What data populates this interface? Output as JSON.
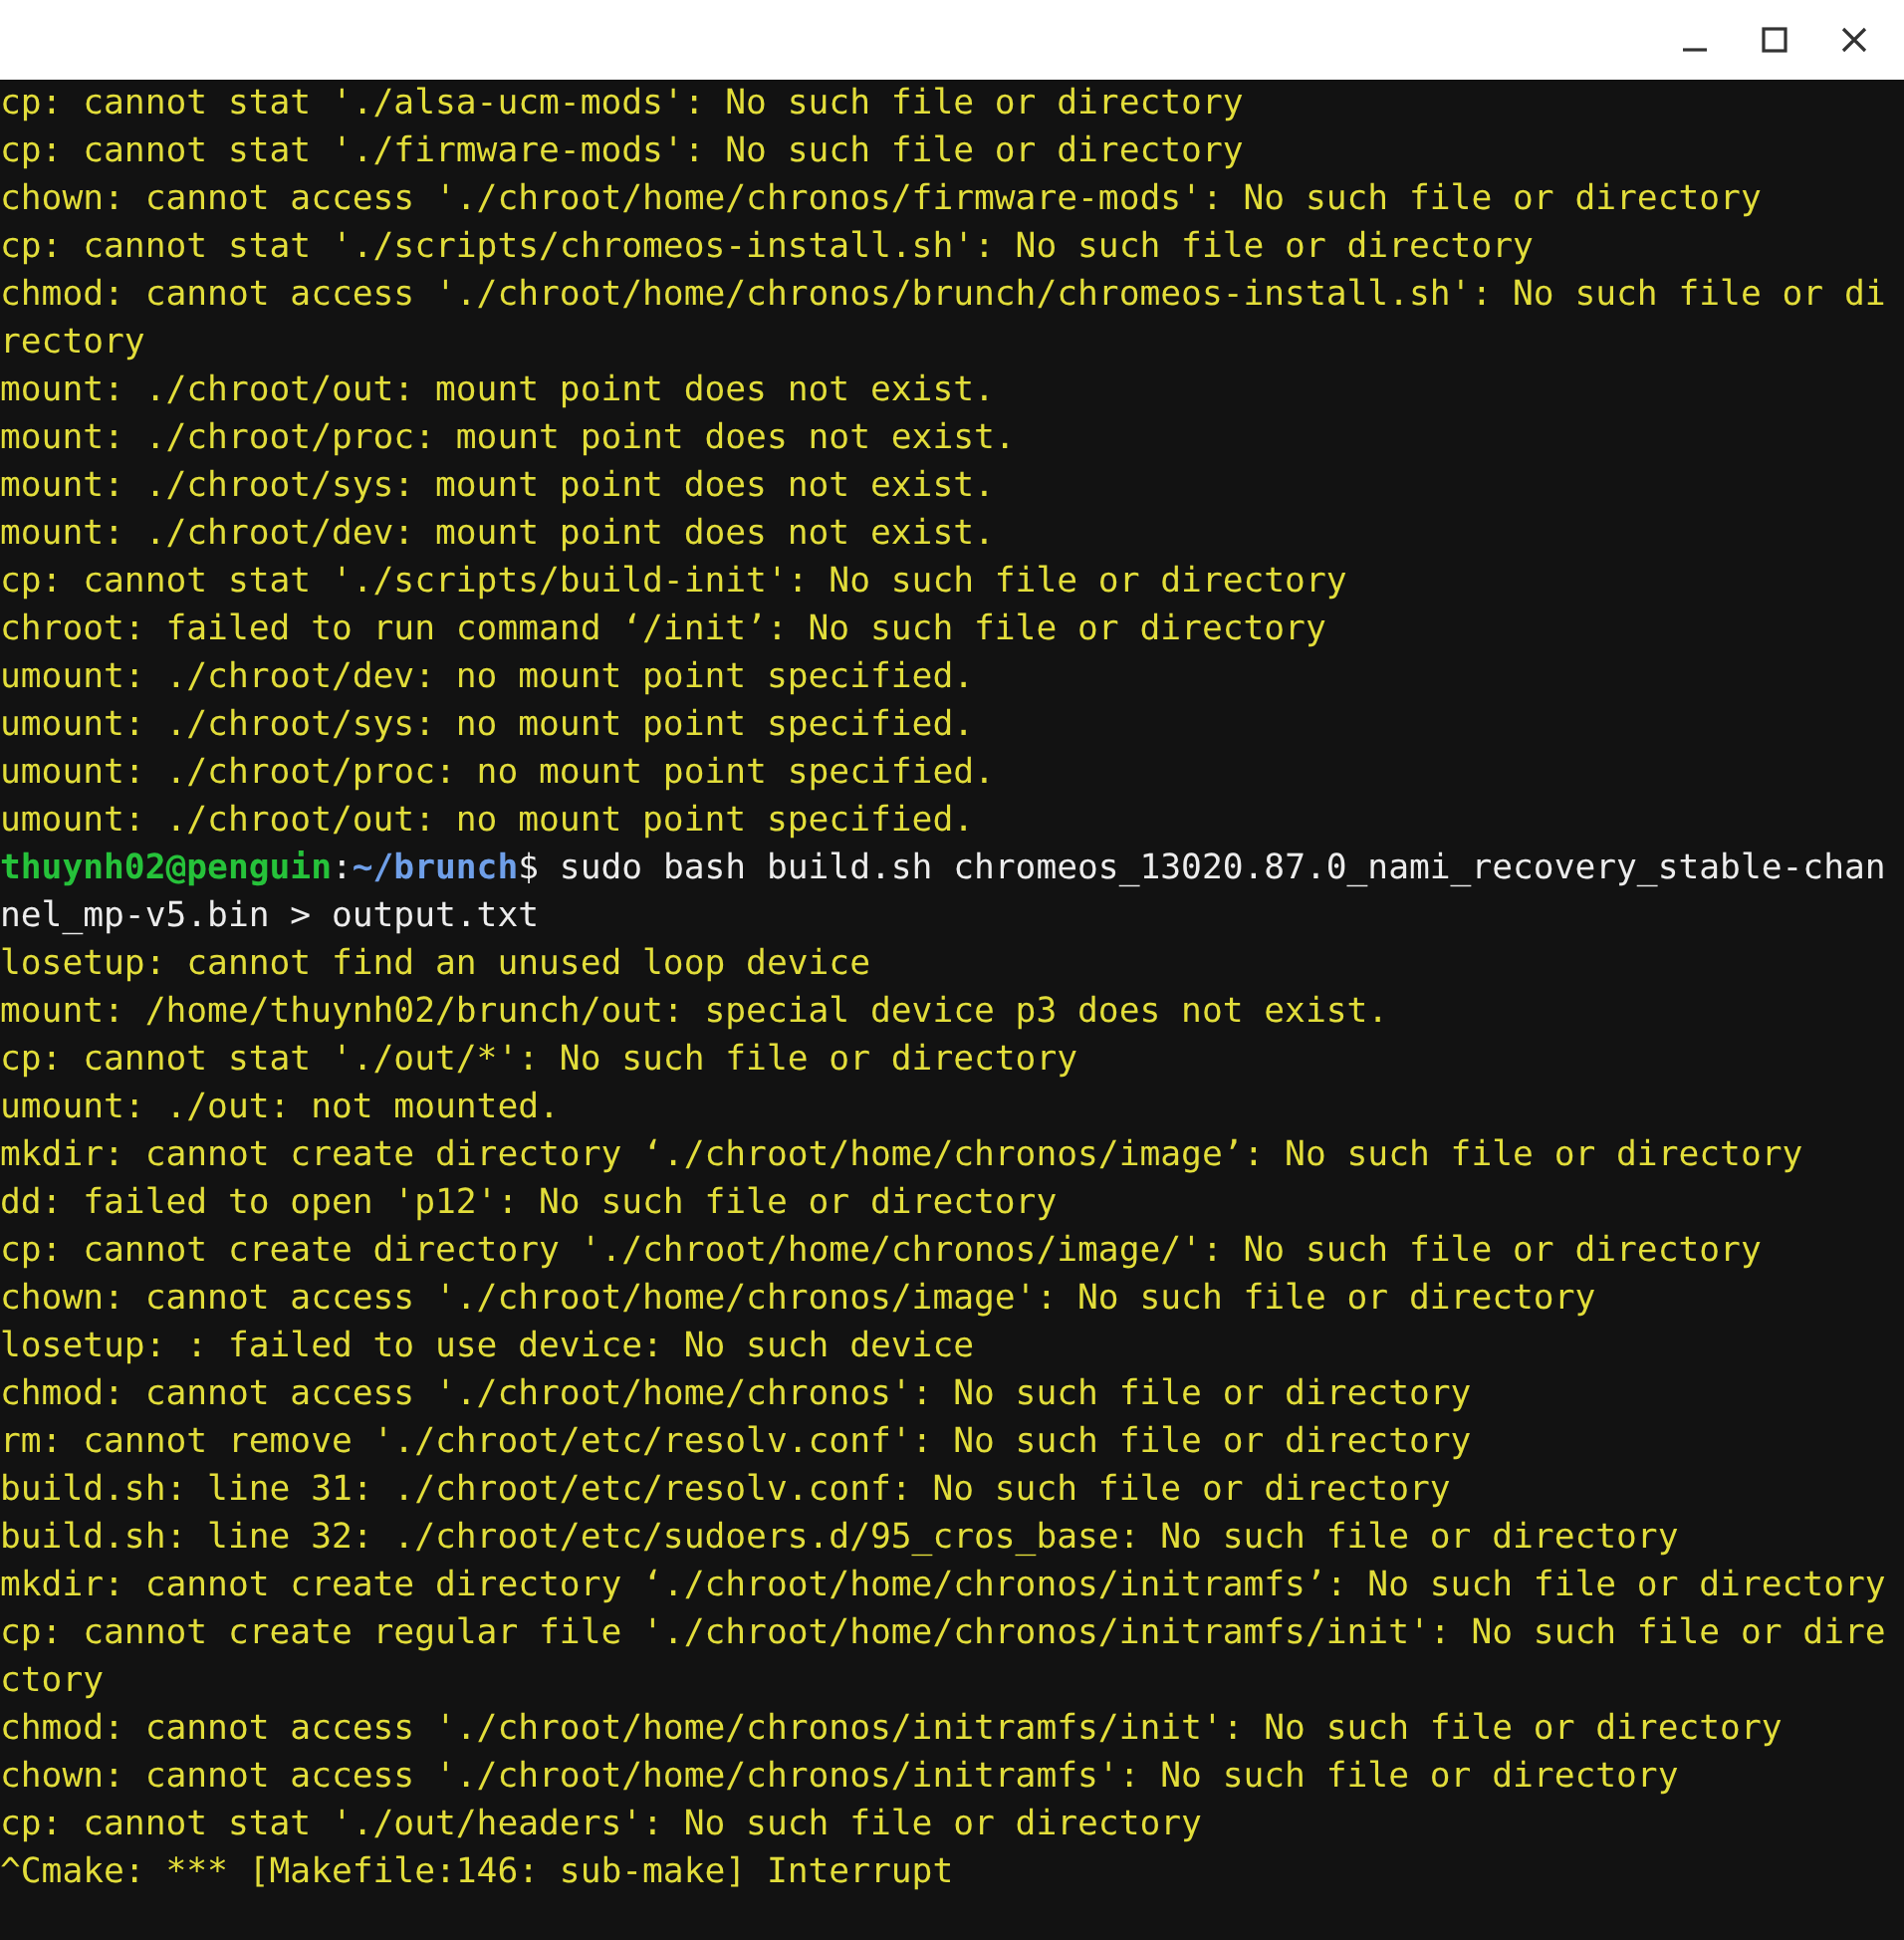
{
  "window": {
    "controls": [
      {
        "kind": "minimize"
      },
      {
        "kind": "maximize"
      },
      {
        "kind": "close"
      }
    ]
  },
  "terminal": {
    "lines": [
      {
        "kind": "output",
        "text": "cp: cannot stat './alsa-ucm-mods': No such file or directory"
      },
      {
        "kind": "output",
        "text": "cp: cannot stat './firmware-mods': No such file or directory"
      },
      {
        "kind": "output",
        "text": "chown: cannot access './chroot/home/chronos/firmware-mods': No such file or directory"
      },
      {
        "kind": "output",
        "text": "cp: cannot stat './scripts/chromeos-install.sh': No such file or directory"
      },
      {
        "kind": "output",
        "text": "chmod: cannot access './chroot/home/chronos/brunch/chromeos-install.sh': No such file or di"
      },
      {
        "kind": "output",
        "text": "rectory"
      },
      {
        "kind": "output",
        "text": "mount: ./chroot/out: mount point does not exist."
      },
      {
        "kind": "output",
        "text": "mount: ./chroot/proc: mount point does not exist."
      },
      {
        "kind": "output",
        "text": "mount: ./chroot/sys: mount point does not exist."
      },
      {
        "kind": "output",
        "text": "mount: ./chroot/dev: mount point does not exist."
      },
      {
        "kind": "output",
        "text": "cp: cannot stat './scripts/build-init': No such file or directory"
      },
      {
        "kind": "output",
        "text": "chroot: failed to run command ‘/init’: No such file or directory"
      },
      {
        "kind": "output",
        "text": "umount: ./chroot/dev: no mount point specified."
      },
      {
        "kind": "output",
        "text": "umount: ./chroot/sys: no mount point specified."
      },
      {
        "kind": "output",
        "text": "umount: ./chroot/proc: no mount point specified."
      },
      {
        "kind": "output",
        "text": "umount: ./chroot/out: no mount point specified."
      },
      {
        "kind": "prompt",
        "segments": [
          {
            "kind": "user",
            "text": "thuynh02@penguin"
          },
          {
            "kind": "plain",
            "text": ":"
          },
          {
            "kind": "path",
            "text": "~/brunch"
          },
          {
            "kind": "plain",
            "text": "$ sudo bash build.sh chromeos_13020.87.0_nami_recovery_stable-chan"
          }
        ]
      },
      {
        "kind": "command",
        "text": "nel_mp-v5.bin > output.txt"
      },
      {
        "kind": "output",
        "text": "losetup: cannot find an unused loop device"
      },
      {
        "kind": "output",
        "text": "mount: /home/thuynh02/brunch/out: special device p3 does not exist."
      },
      {
        "kind": "output",
        "text": "cp: cannot stat './out/*': No such file or directory"
      },
      {
        "kind": "output",
        "text": "umount: ./out: not mounted."
      },
      {
        "kind": "output",
        "text": "mkdir: cannot create directory ‘./chroot/home/chronos/image’: No such file or directory"
      },
      {
        "kind": "output",
        "text": "dd: failed to open 'p12': No such file or directory"
      },
      {
        "kind": "output",
        "text": "cp: cannot create directory './chroot/home/chronos/image/': No such file or directory"
      },
      {
        "kind": "output",
        "text": "chown: cannot access './chroot/home/chronos/image': No such file or directory"
      },
      {
        "kind": "output",
        "text": "losetup: : failed to use device: No such device"
      },
      {
        "kind": "output",
        "text": "chmod: cannot access './chroot/home/chronos': No such file or directory"
      },
      {
        "kind": "output",
        "text": "rm: cannot remove './chroot/etc/resolv.conf': No such file or directory"
      },
      {
        "kind": "output",
        "text": "build.sh: line 31: ./chroot/etc/resolv.conf: No such file or directory"
      },
      {
        "kind": "output",
        "text": "build.sh: line 32: ./chroot/etc/sudoers.d/95_cros_base: No such file or directory"
      },
      {
        "kind": "output",
        "text": "mkdir: cannot create directory ‘./chroot/home/chronos/initramfs’: No such file or directory"
      },
      {
        "kind": "output",
        "text": "cp: cannot create regular file './chroot/home/chronos/initramfs/init': No such file or dire"
      },
      {
        "kind": "output",
        "text": "ctory"
      },
      {
        "kind": "output",
        "text": "chmod: cannot access './chroot/home/chronos/initramfs/init': No such file or directory"
      },
      {
        "kind": "output",
        "text": "chown: cannot access './chroot/home/chronos/initramfs': No such file or directory"
      },
      {
        "kind": "output",
        "text": "cp: cannot stat './out/headers': No such file or directory"
      },
      {
        "kind": "output",
        "text": "^Cmake: *** [Makefile:146: sub-make] Interrupt"
      }
    ]
  }
}
